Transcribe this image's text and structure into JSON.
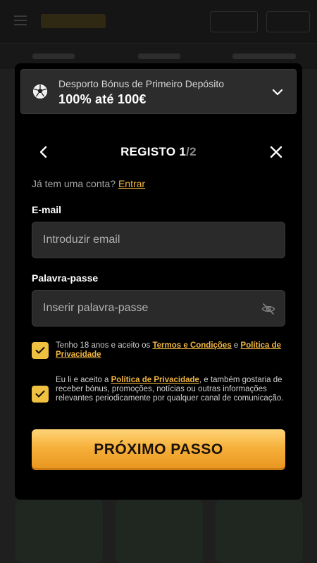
{
  "bonus": {
    "subtitle": "Desporto Bónus de Primeiro Depósito",
    "headline": "100% até 100€"
  },
  "header": {
    "title_main": "REGISTO 1",
    "title_step": "/2"
  },
  "login": {
    "prompt": "Já tem uma conta?",
    "link": "Entrar"
  },
  "email": {
    "label": "E-mail",
    "placeholder": "Introduzir email",
    "value": ""
  },
  "password": {
    "label": "Palavra-passe",
    "placeholder": "Inserir palavra-passe",
    "value": "",
    "visibility_icon": "eye-off-icon"
  },
  "consents": [
    {
      "checked": true,
      "text_1": "Tenho 18 anos e aceito os ",
      "link_1": "Termos e Condições",
      "text_2": " e ",
      "link_2": "Política de Privacidade"
    },
    {
      "checked": true,
      "text_1": "Eu li e aceito a ",
      "link_1": "Política de Privacidade",
      "text_2": ", e também gostaria de receber bónus, promoções, notícias ou outras informações relevantes periodicamente por qualquer canal de comunicação."
    }
  ],
  "next_button": "PRÓXIMO PASSO",
  "colors": {
    "accent": "#f2b740",
    "button_top": "#ffd478",
    "button_bottom": "#e8951f",
    "modal_bg": "#000000",
    "input_bg": "#2a2a2a"
  }
}
